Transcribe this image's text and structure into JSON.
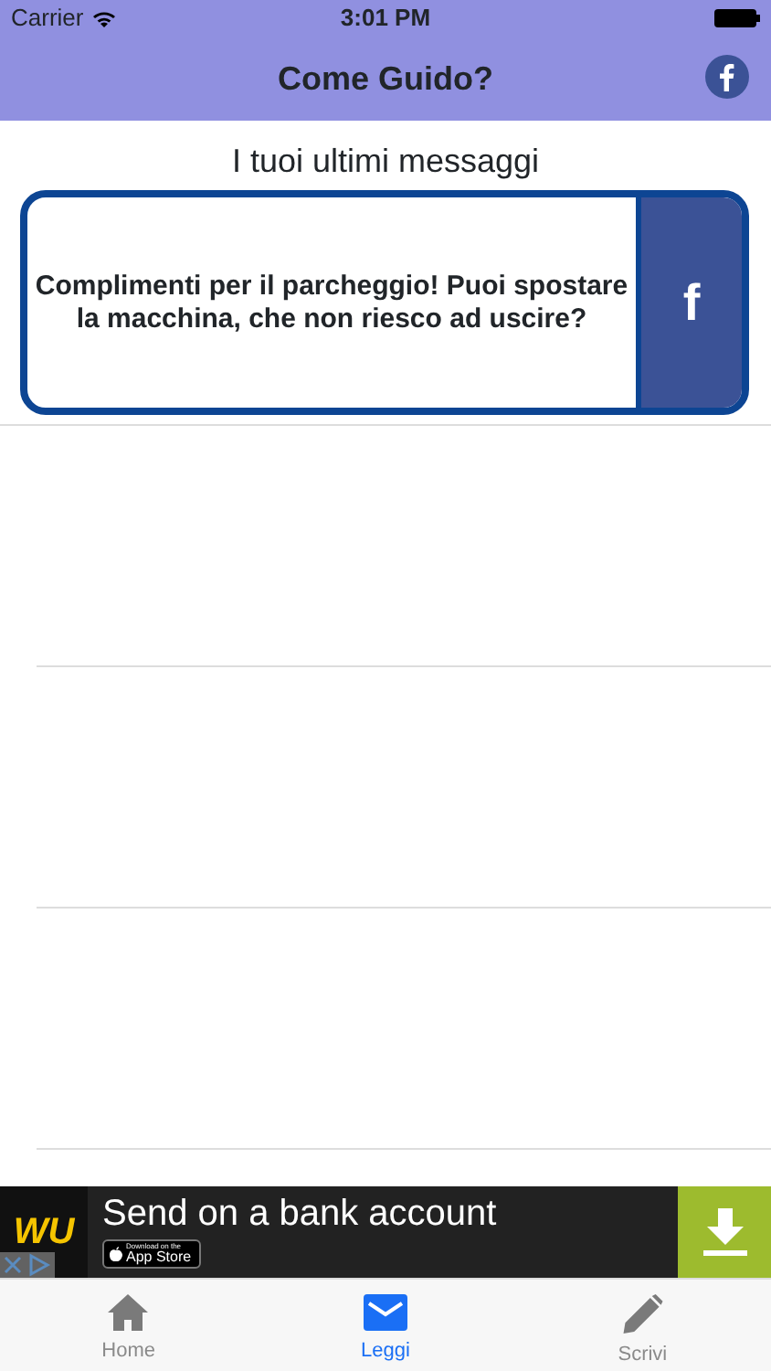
{
  "status_bar": {
    "carrier": "Carrier",
    "time": "3:01 PM"
  },
  "nav_bar": {
    "title": "Come Guido?"
  },
  "heading": "I tuoi ultimi messaggi",
  "messages": [
    {
      "text": "Complimenti per il parcheggio! Puoi spostare la macchina, che non riesco ad uscire?",
      "share_label": "f"
    }
  ],
  "ad": {
    "logo": "WU",
    "text": "Send on a bank account",
    "badge_small": "Download on the",
    "badge_large": "App Store"
  },
  "tabs": [
    {
      "label": "Home",
      "kind": "home",
      "selected": false
    },
    {
      "label": "Leggi",
      "kind": "mail",
      "selected": true
    },
    {
      "label": "Scrivi",
      "kind": "pencil",
      "selected": false
    }
  ]
}
